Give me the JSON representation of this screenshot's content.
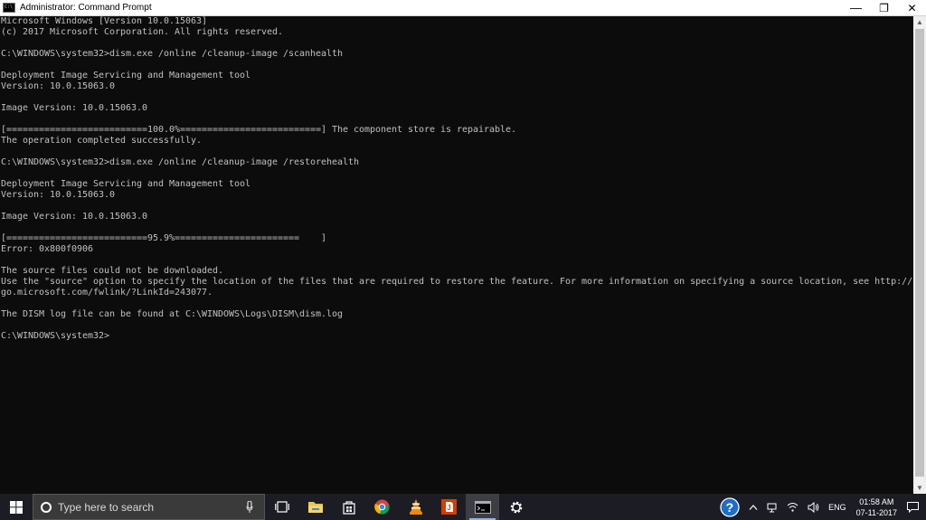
{
  "window": {
    "title": "Administrator: Command Prompt",
    "minimize_glyph": "—",
    "restore_glyph": "❐",
    "close_glyph": "✕"
  },
  "console": {
    "lines": [
      "Microsoft Windows [Version 10.0.15063]",
      "(c) 2017 Microsoft Corporation. All rights reserved.",
      "",
      "C:\\WINDOWS\\system32>dism.exe /online /cleanup-image /scanhealth",
      "",
      "Deployment Image Servicing and Management tool",
      "Version: 10.0.15063.0",
      "",
      "Image Version: 10.0.15063.0",
      "",
      "[==========================100.0%==========================] The component store is repairable.",
      "The operation completed successfully.",
      "",
      "C:\\WINDOWS\\system32>dism.exe /online /cleanup-image /restorehealth",
      "",
      "Deployment Image Servicing and Management tool",
      "Version: 10.0.15063.0",
      "",
      "Image Version: 10.0.15063.0",
      "",
      "[==========================95.9%=======================    ]",
      "Error: 0x800f0906",
      "",
      "The source files could not be downloaded.",
      "Use the \"source\" option to specify the location of the files that are required to restore the feature. For more information on specifying a source location, see http://",
      "go.microsoft.com/fwlink/?LinkId=243077.",
      "",
      "The DISM log file can be found at C:\\WINDOWS\\Logs\\DISM\\dism.log",
      "",
      "C:\\WINDOWS\\system32>"
    ]
  },
  "taskbar": {
    "search_placeholder": "Type here to search",
    "apps": [
      "task-view",
      "file-explorer",
      "store",
      "chrome",
      "vlc",
      "office",
      "command-prompt",
      "settings"
    ],
    "tray": {
      "language": "ENG",
      "time": "01:58 AM",
      "date": "07-11-2017"
    }
  },
  "colors": {
    "console_bg": "#0c0c0c",
    "console_text": "#c0c0c0",
    "taskbar_bg": "#1c1d24"
  }
}
